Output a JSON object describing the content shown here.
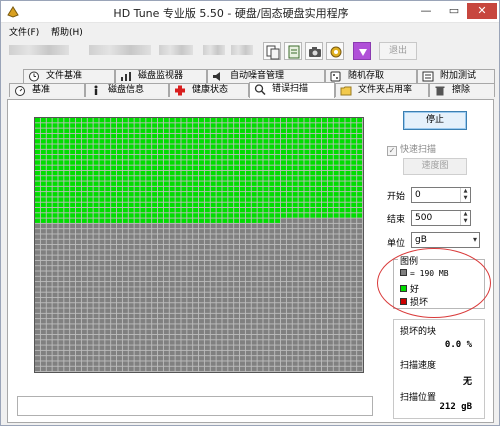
{
  "window": {
    "title": "HD Tune 专业版 5.50 - 硬盘/固态硬盘实用程序",
    "controls": {
      "minimize": "—",
      "maximize": "▭",
      "close": "✕"
    }
  },
  "menu": {
    "file": "文件(F)",
    "help": "帮助(H)"
  },
  "toolbar": {
    "exit_label": "退出"
  },
  "tabs_top": [
    {
      "label": "文件基准",
      "icon": "clock-icon"
    },
    {
      "label": "磁盘监视器",
      "icon": "chart-icon"
    },
    {
      "label": "自动噪音管理",
      "icon": "speaker-icon"
    },
    {
      "label": "随机存取",
      "icon": "dice-icon"
    },
    {
      "label": "附加测试",
      "icon": "tools-icon"
    }
  ],
  "tabs_bottom": [
    {
      "label": "基准",
      "icon": "stopwatch-icon"
    },
    {
      "label": "磁盘信息",
      "icon": "info-icon"
    },
    {
      "label": "健康状态",
      "icon": "health-cross-icon"
    },
    {
      "label": "错误扫描",
      "icon": "magnifier-icon"
    },
    {
      "label": "文件夹占用率",
      "icon": "folder-icon"
    },
    {
      "label": "擦除",
      "icon": "trash-icon"
    }
  ],
  "error_scan": {
    "stop_button": "停止",
    "quick_scan_label": "快速扫描",
    "quick_scan_checked": true,
    "speed_map_button": "速度图",
    "start_label": "开始",
    "start_value": "0",
    "end_label": "结束",
    "end_value": "500",
    "unit_label": "单位",
    "unit_value": "gB"
  },
  "legend": {
    "title": "图例",
    "block_size": "= 190 MB",
    "good": "好",
    "bad": "损坏"
  },
  "stats": {
    "damaged_label": "损坏的块",
    "damaged_value": "0.0 %",
    "speed_label": "扫描速度",
    "speed_value": "无",
    "position_label": "扫描位置",
    "position_value": "212 gB"
  },
  "scan_progress": {
    "total_blocks": 2688,
    "scanned_good_blocks": 1106,
    "bad_blocks": 0
  },
  "colors": {
    "good": "#00dd00",
    "pending": "#808080",
    "bad": "#cc0000",
    "grid_line": "#2b2b2b",
    "annotation": "#d93a3a"
  }
}
